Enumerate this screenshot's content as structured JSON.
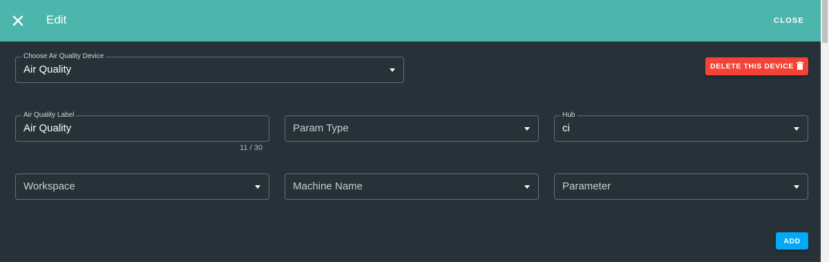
{
  "header": {
    "title": "Edit",
    "close_label": "CLOSE",
    "close_icon": "close-icon"
  },
  "device_select": {
    "label": "Choose Air Quality Device",
    "value": "Air Quality"
  },
  "delete_button": {
    "label": "DELETE THIS DEVICE",
    "icon": "trash-icon"
  },
  "label_field": {
    "label": "Air Quality Label",
    "value": "Air Quality",
    "counter": "11 / 30"
  },
  "param_type": {
    "placeholder": "Param Type"
  },
  "hub": {
    "label": "Hub",
    "value": "ci"
  },
  "workspace": {
    "placeholder": "Workspace"
  },
  "machine_name": {
    "placeholder": "Machine Name"
  },
  "parameter": {
    "placeholder": "Parameter"
  },
  "add_button": {
    "label": "ADD"
  },
  "colors": {
    "toolbar": "#4db6ac",
    "background": "#263238",
    "delete": "#f44336",
    "add": "#03a9f4"
  }
}
